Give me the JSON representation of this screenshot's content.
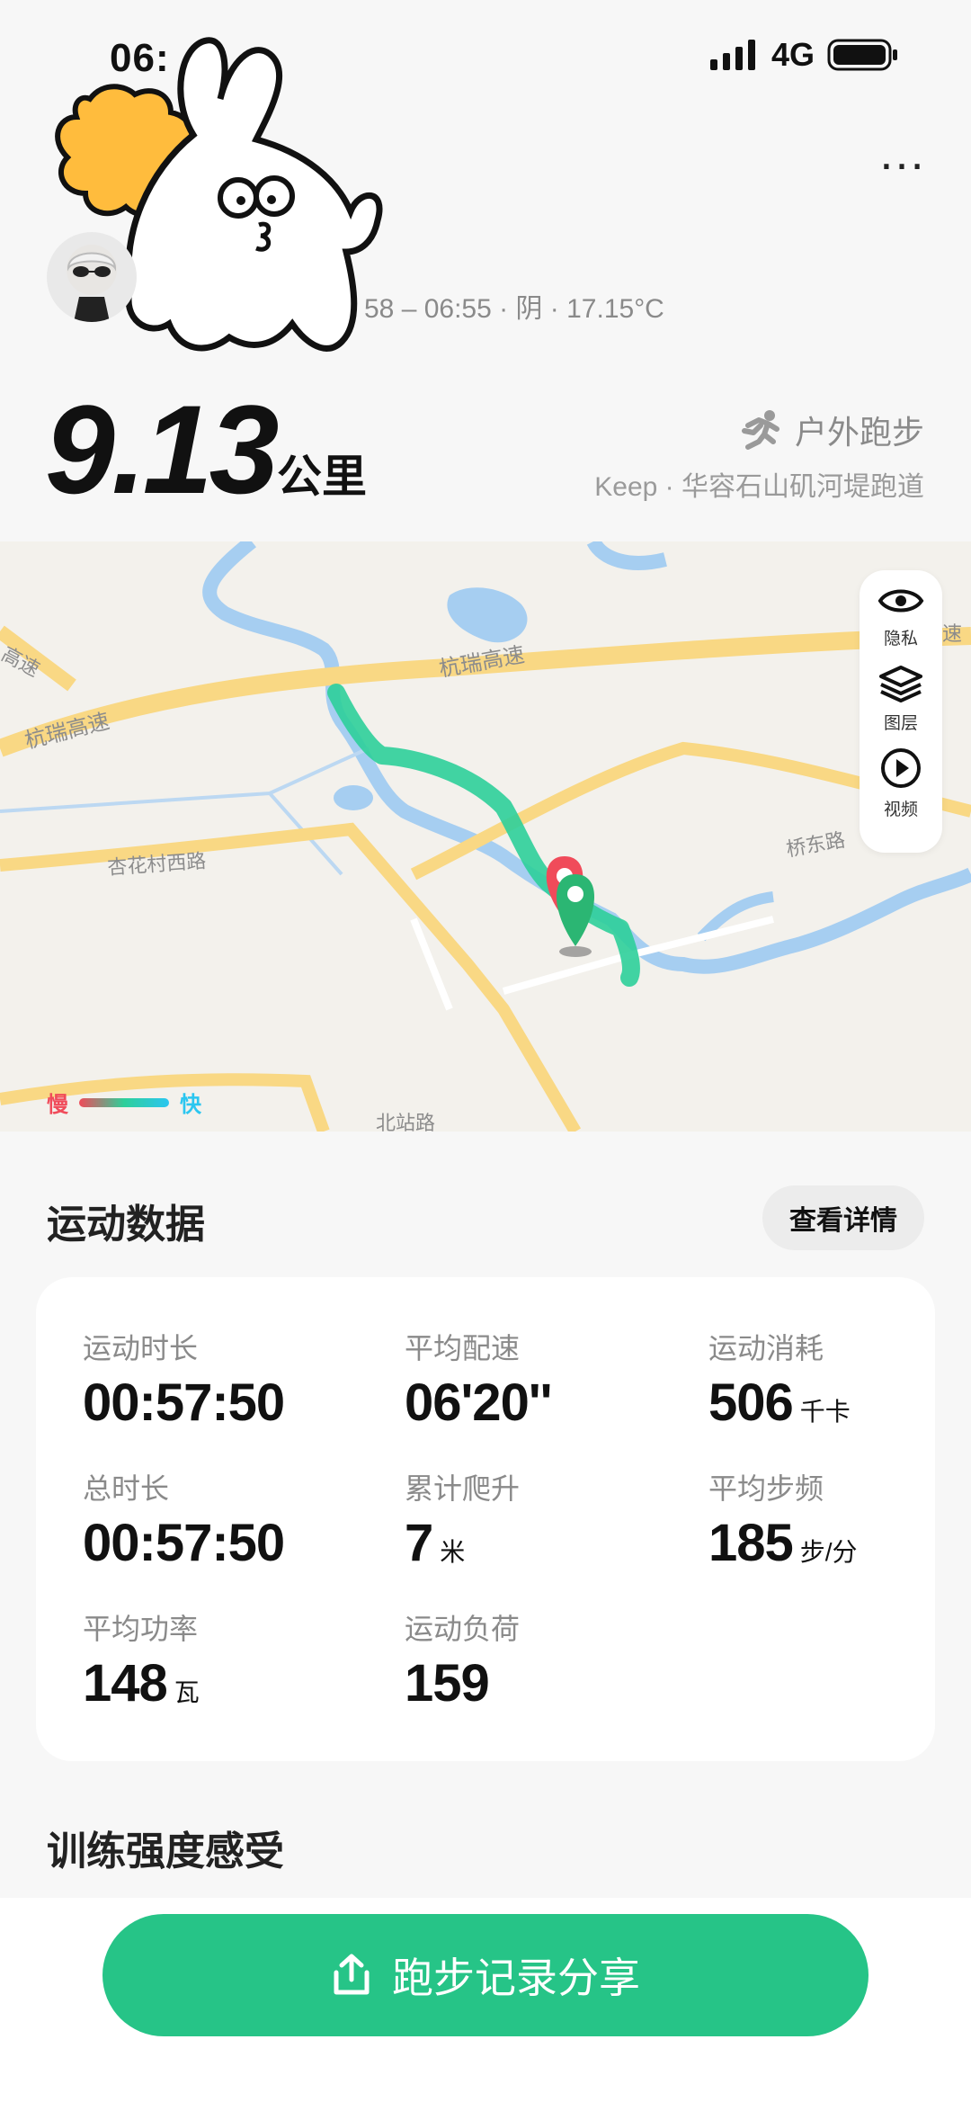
{
  "status_bar": {
    "time": "06:",
    "network": "4G"
  },
  "header": {
    "meta": "58 – 06:55 · 阴 · 17.15°C"
  },
  "summary": {
    "distance": "9.13",
    "distance_unit": "公里",
    "sport_type": "户外跑步",
    "route": "Keep · 华容石山矶河堤跑道"
  },
  "map": {
    "road_labels": [
      "杭瑞高速",
      "杭瑞高速",
      "高速",
      "速",
      "杏花村西路",
      "桥东路",
      "北站路"
    ],
    "tools": [
      "隐私",
      "图层",
      "视频"
    ],
    "legend": {
      "slow": "慢",
      "fast": "快"
    },
    "colors": {
      "track": "#2ecf9a",
      "road": "#f9d884",
      "water": "#a6cef1",
      "start": "#2bb673",
      "end": "#f04b5a"
    }
  },
  "sport_data": {
    "title": "运动数据",
    "details_button": "查看详情",
    "stats": [
      {
        "label": "运动时长",
        "value": "00:57:50",
        "unit": ""
      },
      {
        "label": "平均配速",
        "value": "06'20''",
        "unit": ""
      },
      {
        "label": "运动消耗",
        "value": "506",
        "unit": "千卡"
      },
      {
        "label": "总时长",
        "value": "00:57:50",
        "unit": ""
      },
      {
        "label": "累计爬升",
        "value": "7",
        "unit": "米"
      },
      {
        "label": "平均步频",
        "value": "185",
        "unit": "步/分"
      },
      {
        "label": "平均功率",
        "value": "148",
        "unit": "瓦"
      },
      {
        "label": "运动负荷",
        "value": "159",
        "unit": ""
      }
    ]
  },
  "training": {
    "title": "训练强度感受"
  },
  "share": {
    "label": "跑步记录分享",
    "color": "#26c487"
  }
}
